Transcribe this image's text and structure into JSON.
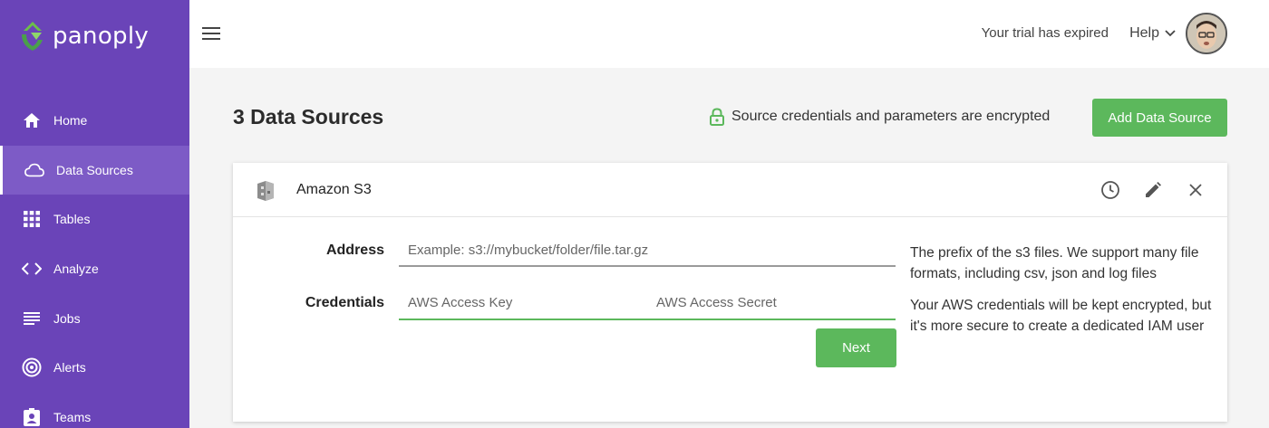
{
  "app": {
    "name": "panoply"
  },
  "sidebar": {
    "items": [
      {
        "label": "Home",
        "icon": "home-icon",
        "active": false
      },
      {
        "label": "Data Sources",
        "icon": "cloud-icon",
        "active": true
      },
      {
        "label": "Tables",
        "icon": "grid-icon",
        "active": false
      },
      {
        "label": "Analyze",
        "icon": "code-icon",
        "active": false
      },
      {
        "label": "Jobs",
        "icon": "list-icon",
        "active": false
      },
      {
        "label": "Alerts",
        "icon": "alert-radar-icon",
        "active": false
      },
      {
        "label": "Teams",
        "icon": "badge-icon",
        "active": false
      }
    ]
  },
  "header": {
    "trial_text": "Your trial has expired",
    "help_label": "Help"
  },
  "main": {
    "title": "3 Data Sources",
    "encrypted_note": "Source credentials and parameters are encrypted",
    "add_button": "Add Data Source"
  },
  "source_card": {
    "title": "Amazon S3",
    "address": {
      "label": "Address",
      "placeholder": "Example: s3://mybucket/folder/file.tar.gz",
      "value": "",
      "help": "The prefix of the s3 files. We support many file formats, including csv, json and log files"
    },
    "credentials": {
      "label": "Credentials",
      "key_placeholder": "AWS Access Key",
      "secret_placeholder": "AWS Access Secret",
      "key_value": "",
      "secret_value": "",
      "help": "Your AWS credentials will be kept encrypted, but it's more secure to create a dedicated IAM user"
    },
    "next_button": "Next"
  },
  "colors": {
    "sidebar": "#6a44b8",
    "accent_green": "#5cb85c"
  }
}
